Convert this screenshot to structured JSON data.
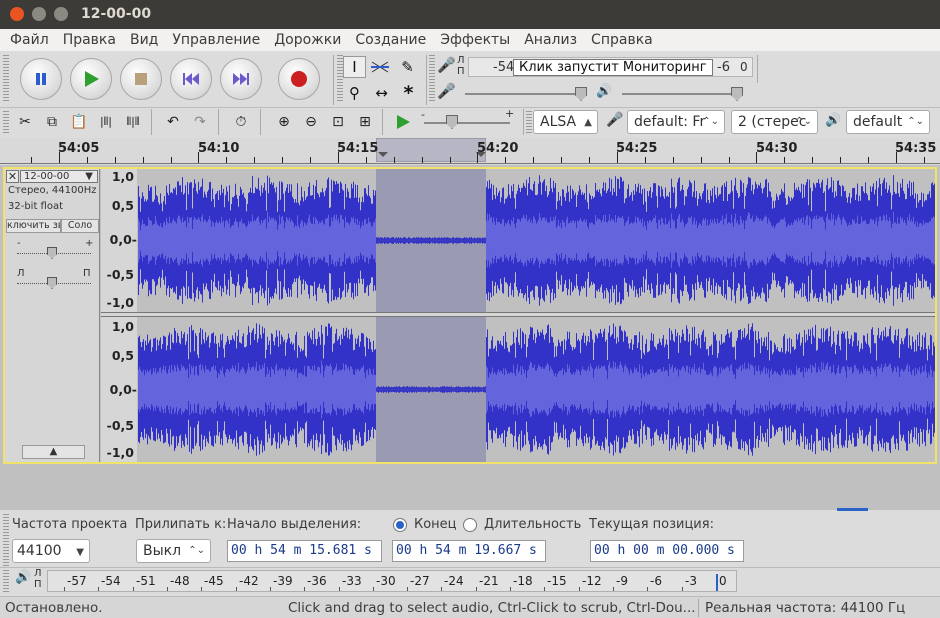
{
  "window": {
    "title": "12-00-00"
  },
  "menu": [
    "Файл",
    "Правка",
    "Вид",
    "Управление",
    "Дорожки",
    "Создание",
    "Эффекты",
    "Анализ",
    "Справка"
  ],
  "meters": {
    "record_lp": "Л\nП",
    "record_scale_left": "-54",
    "record_prompt": "Клик запустит Мониторинг",
    "record_scale_right": "-6",
    "record_scale_end": "0"
  },
  "device": {
    "host": "ALSA",
    "input": "default: Fr",
    "channels": "2 (стерес",
    "output": "default"
  },
  "ruler": {
    "labels": [
      "54:05",
      "54:10",
      "54:15",
      "54:20",
      "54:25",
      "54:30",
      "54:35"
    ]
  },
  "track": {
    "name": "12-00-00",
    "info1": "Стерео, 44100Hz",
    "info2": "32-bit float",
    "mute": "ключить звук",
    "solo": "Соло",
    "gain_minus": "-",
    "gain_plus": "+",
    "pan_l": "Л",
    "pan_r": "П",
    "amp_labels": [
      "1,0",
      "0,5",
      "0,0-",
      "-0,5",
      "-1,0"
    ]
  },
  "selection_bar": {
    "project_rate_label": "Частота проекта",
    "snap_label": "Прилипать к:",
    "start_label": "Начало выделения:",
    "end_label": "Конец",
    "length_label": "Длительность",
    "position_label": "Текущая позиция:",
    "project_rate": "44100",
    "snap_value": "Выкл",
    "start": "00 h 54 m 15.681 s",
    "end": "00 h 54 m 19.667 s",
    "position": "00 h 00 m 00.000 s",
    "end_selected": true
  },
  "play_meter": {
    "lp": "Л\nП",
    "scale": [
      "-57",
      "-54",
      "-51",
      "-48",
      "-45",
      "-42",
      "-39",
      "-36",
      "-33",
      "-30",
      "-27",
      "-24",
      "-21",
      "-18",
      "-15",
      "-12",
      "-9",
      "-6",
      "-3",
      "0"
    ]
  },
  "status": {
    "state": "Остановлено.",
    "hint": "Click and drag to select audio, Ctrl-Click to scrub, Ctrl-Dou...",
    "rate": "Реальная частота: 44100 Гц"
  },
  "colors": {
    "wave_dark": "#3232c8",
    "wave_light": "#6464dc",
    "selection": "#9a9ab2",
    "track_border": "#f1e36a"
  }
}
